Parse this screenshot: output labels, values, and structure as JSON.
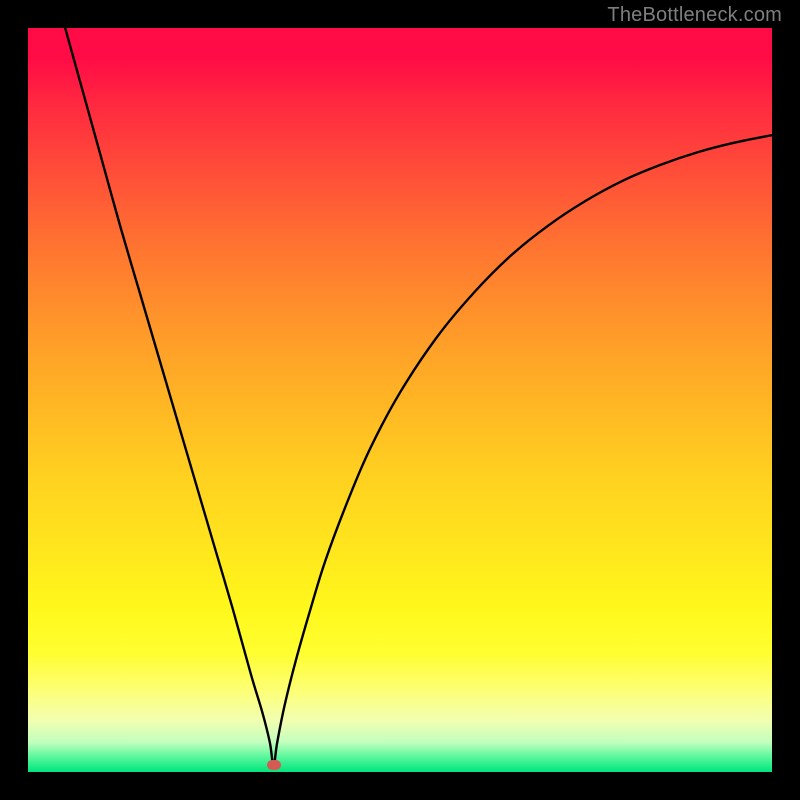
{
  "watermark": "TheBottleneck.com",
  "marker": {
    "x_pct": 33.0,
    "y_pct": 99.1
  },
  "chart_data": {
    "type": "line",
    "title": "",
    "xlabel": "",
    "ylabel": "",
    "xlim": [
      0,
      100
    ],
    "ylim": [
      0,
      100
    ],
    "background_gradient": {
      "orientation": "vertical",
      "stops": [
        {
          "pct": 0,
          "color": "#ff0b46"
        },
        {
          "pct": 25,
          "color": "#ff6a34"
        },
        {
          "pct": 50,
          "color": "#ffb524"
        },
        {
          "pct": 75,
          "color": "#fff11d"
        },
        {
          "pct": 100,
          "color": "#00e57d"
        }
      ]
    },
    "minimum_marker": {
      "x": 33.0,
      "y": 0.9,
      "color": "#d45a54"
    },
    "series": [
      {
        "name": "bottleneck-curve",
        "color": "#000000",
        "x": [
          5.0,
          7.5,
          10.0,
          12.5,
          15.0,
          17.5,
          20.0,
          22.5,
          25.0,
          27.5,
          30.0,
          31.5,
          32.5,
          33.0,
          33.5,
          34.5,
          36.0,
          38.0,
          40.0,
          43.0,
          46.0,
          50.0,
          55.0,
          60.0,
          65.0,
          70.0,
          75.0,
          80.0,
          85.0,
          90.0,
          95.0,
          100.0
        ],
        "y": [
          100.0,
          91.0,
          82.0,
          73.0,
          64.5,
          56.0,
          47.5,
          39.0,
          30.5,
          22.0,
          13.0,
          8.0,
          4.0,
          0.9,
          4.0,
          9.0,
          15.0,
          22.0,
          28.5,
          36.5,
          43.5,
          51.0,
          58.5,
          64.5,
          69.5,
          73.5,
          76.8,
          79.5,
          81.6,
          83.3,
          84.6,
          85.6
        ]
      }
    ]
  }
}
